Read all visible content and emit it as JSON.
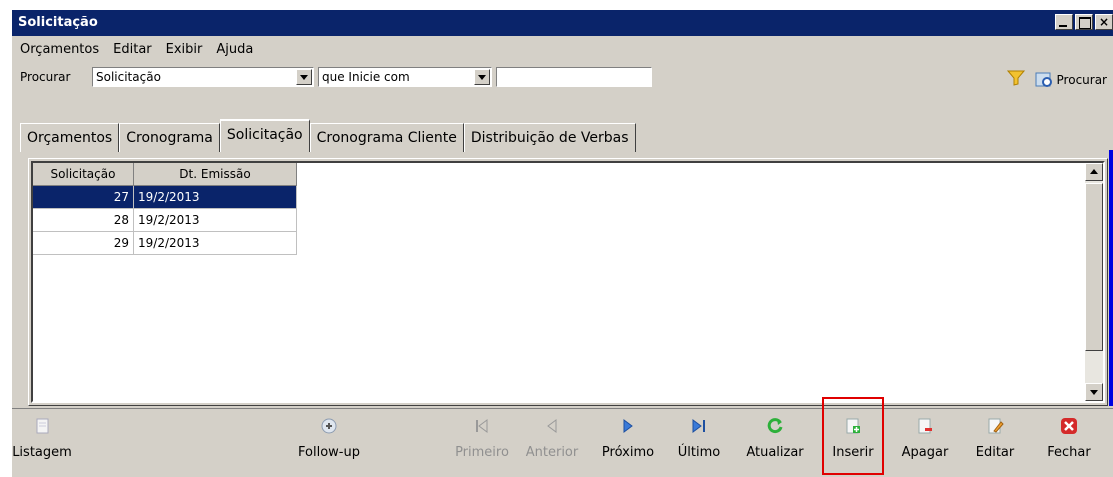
{
  "window": {
    "title": "Solicitação"
  },
  "menu": {
    "items": [
      "Orçamentos",
      "Editar",
      "Exibir",
      "Ajuda"
    ]
  },
  "search": {
    "label": "Procurar",
    "field": "Solicitação",
    "mode": "que Inicie com",
    "value": "",
    "button_label": "Procurar"
  },
  "tabs": [
    "Orçamentos",
    "Cronograma",
    "Solicitação",
    "Cronograma Cliente",
    "Distribuição de Verbas"
  ],
  "table": {
    "headers": [
      "Solicitação",
      "Dt. Emissão"
    ],
    "rows": [
      [
        "27",
        "19/2/2013"
      ],
      [
        "28",
        "19/2/2013"
      ],
      [
        "29",
        "19/2/2013"
      ]
    ]
  },
  "toolbar": {
    "listagem": "Listagem",
    "followup": "Follow-up",
    "primeiro": "Primeiro",
    "anterior": "Anterior",
    "proximo": "Próximo",
    "ultimo": "Último",
    "atualizar": "Atualizar",
    "inserir": "Inserir",
    "apagar": "Apagar",
    "editar": "Editar",
    "fechar": "Fechar"
  },
  "icons": {
    "filter": "filter-icon",
    "search": "search-icon"
  },
  "colors": {
    "titlebar": "#0a246a",
    "selection": "#0a246a",
    "highlight": "#e00000"
  }
}
